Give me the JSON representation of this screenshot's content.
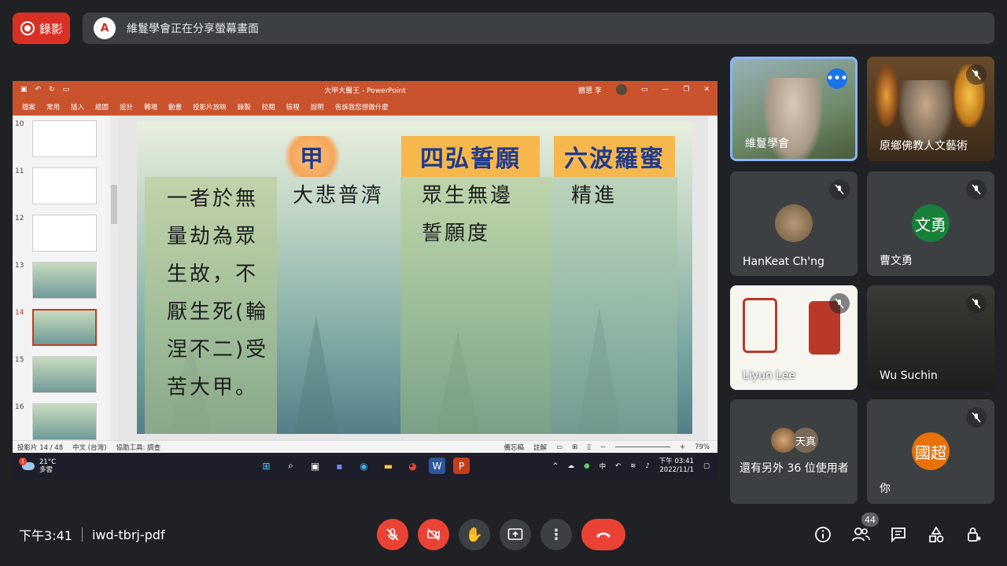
{
  "recording": {
    "label": "錄影"
  },
  "share_banner": {
    "logo_text": "A",
    "text": "維鬘學會正在分享螢幕畫面"
  },
  "powerpoint": {
    "window_title": "大甲大醫王 - PowerPoint",
    "user_name": "鶴慧 李",
    "menu": [
      "檔案",
      "常用",
      "插入",
      "繪圖",
      "設計",
      "轉場",
      "動畫",
      "投影片放映",
      "錄製",
      "校閱",
      "檢視",
      "說明",
      "告訴我您想做什麼"
    ],
    "thumbnails": [
      {
        "num": "10",
        "active": false
      },
      {
        "num": "11",
        "active": false
      },
      {
        "num": "12",
        "active": false
      },
      {
        "num": "13",
        "active": false
      },
      {
        "num": "14",
        "active": true
      },
      {
        "num": "15",
        "active": false
      },
      {
        "num": "16",
        "active": false
      }
    ],
    "slide": {
      "headers": [
        "甲",
        "四弘誓願",
        "六波羅蜜"
      ],
      "col1": [
        "一者於無",
        "量劫為眾",
        "生故，不",
        "厭生死(輪",
        "涅不二)受",
        "苦大甲。"
      ],
      "col2": [
        "大悲普濟"
      ],
      "col3": [
        "眾生無邊",
        "誓願度"
      ],
      "col4": [
        "精進"
      ]
    },
    "status": {
      "slide_count": "投影片 14 / 48",
      "language": "中文 (台灣)",
      "accessibility": "協助工具: 調查",
      "notes": "備忘稿",
      "comments": "註解",
      "zoom": "79%"
    },
    "taskbar": {
      "temp": "21°C",
      "weather": "多雲",
      "weather_badge": "1",
      "ime": "中",
      "time": "下午 03:41",
      "date": "2022/11/1"
    }
  },
  "participants": [
    {
      "name": "維鬘學會",
      "type": "video",
      "speaking": true
    },
    {
      "name": "原鄉佛教人文藝術",
      "type": "video"
    },
    {
      "name": "HanKeat Ch'ng",
      "type": "avatar",
      "avatar_color": "#7a5a3a"
    },
    {
      "name": "曹文勇",
      "type": "avatar",
      "avatar_text": "文勇",
      "avatar_color": "#188038"
    },
    {
      "name": "Liyun Lee",
      "type": "image"
    },
    {
      "name": "Wu Suchin",
      "type": "dark"
    },
    {
      "name": "還有另外 36 位使用者",
      "type": "group",
      "avatar_text": "天真"
    },
    {
      "name": "你",
      "type": "avatar",
      "avatar_text": "國超",
      "avatar_color": "#e8710a"
    }
  ],
  "bottom": {
    "time": "下午3:41",
    "meeting_code": "iwd-tbrj-pdf",
    "participant_count": "44"
  }
}
